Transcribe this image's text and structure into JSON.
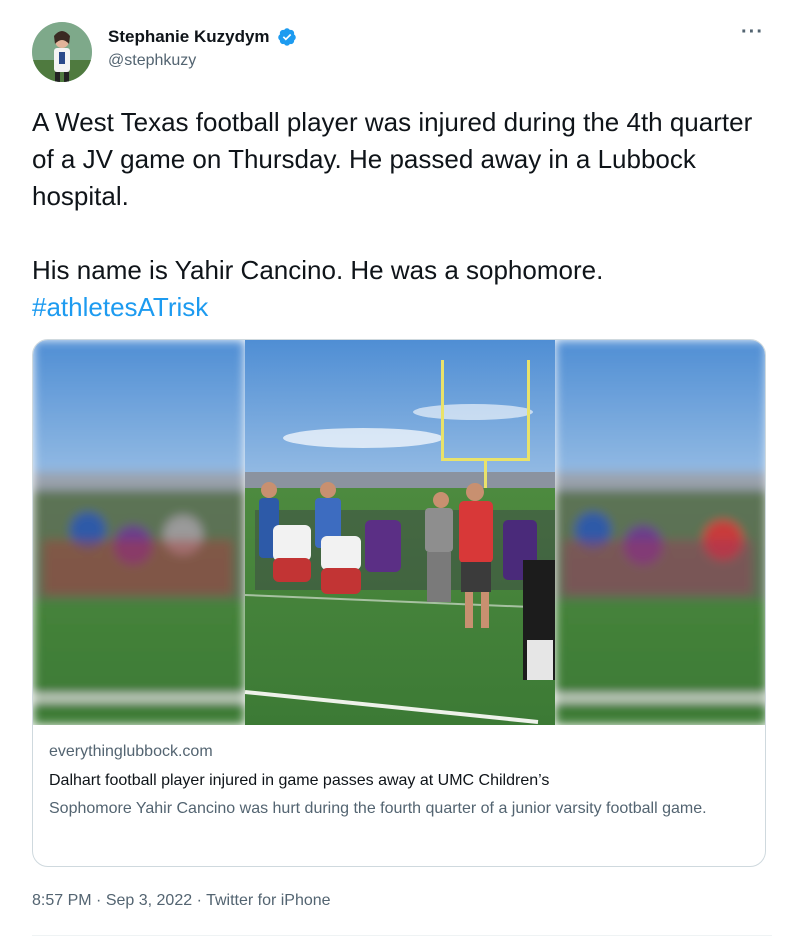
{
  "author": {
    "display_name": "Stephanie Kuzydym",
    "handle": "@stephkuzy",
    "verified": true
  },
  "more_label": "···",
  "tweet": {
    "line1": "A West Texas football player was injured during the 4th quarter of a JV game on Thursday. He passed away in a Lubbock hospital.",
    "line2": "His name is Yahir Cancino. He was a sophomore.",
    "hashtag": "#athletesATrisk"
  },
  "card": {
    "domain": "everythinglubbock.com",
    "title": "Dalhart football player injured in game passes away at UMC Children’s",
    "description": "Sophomore Yahir Cancino was hurt during the fourth quarter of a junior varsity football game."
  },
  "meta": {
    "time": "8:57 PM",
    "separator": "·",
    "date": "Sep 3, 2022",
    "source": "Twitter for iPhone"
  },
  "colors": {
    "link": "#1d9bf0",
    "secondary_text": "#536471",
    "verified_badge": "#1d9bf0"
  }
}
